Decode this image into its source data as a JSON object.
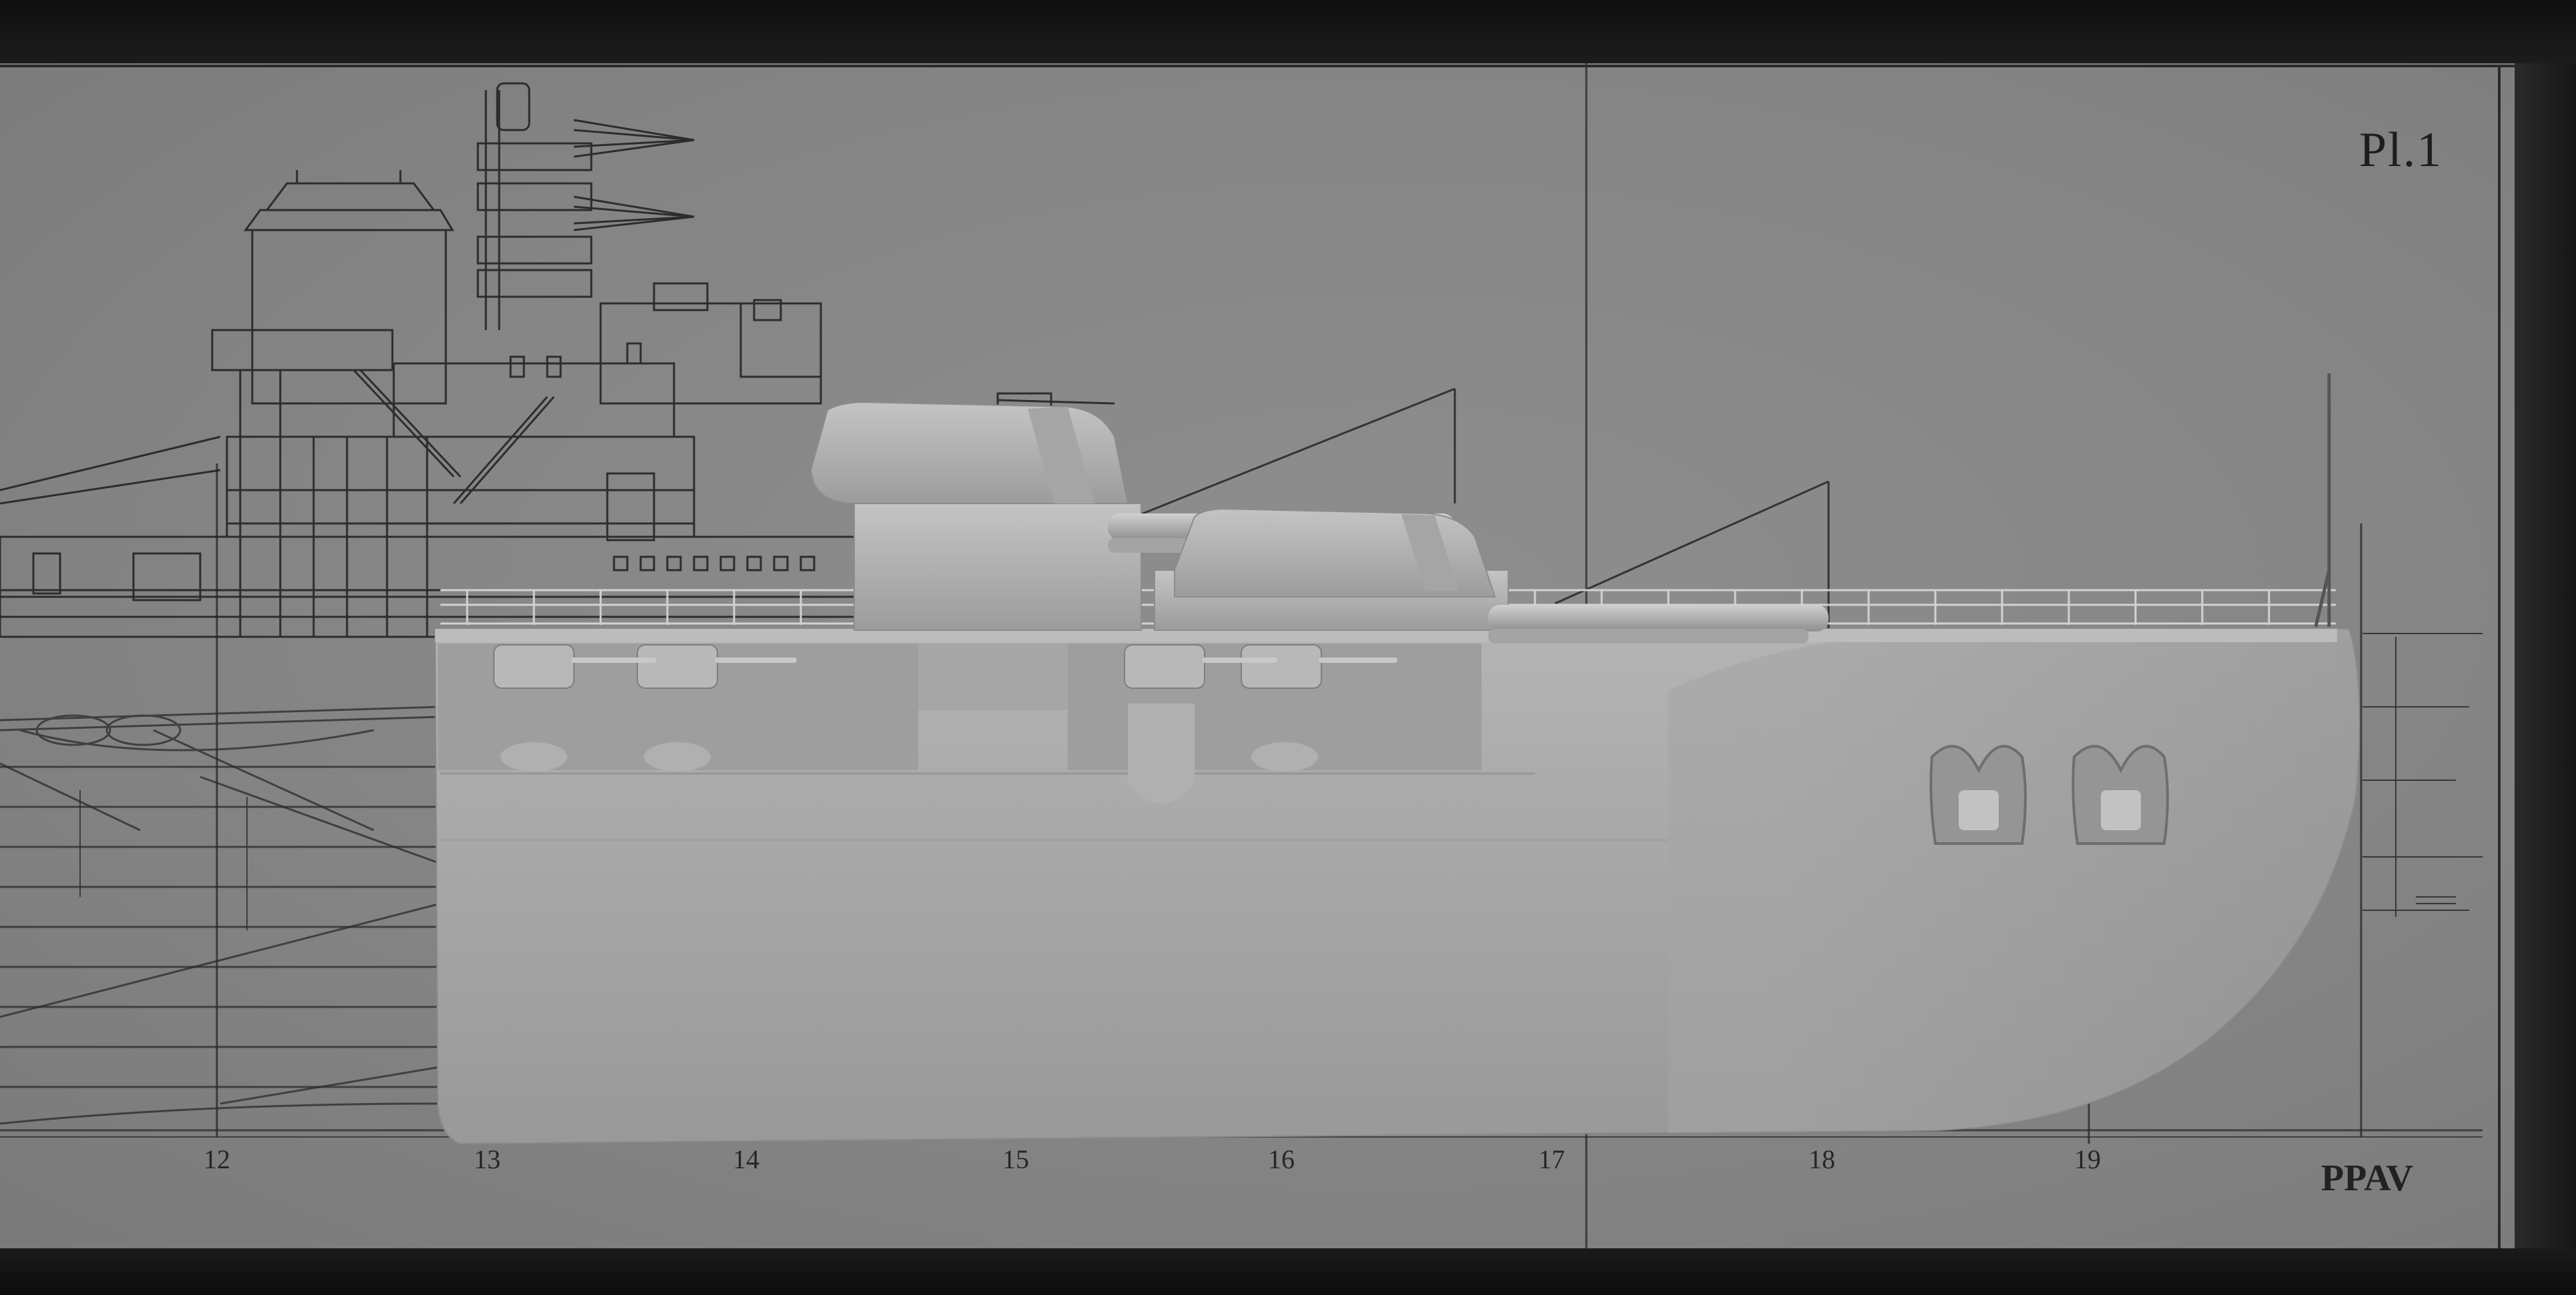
{
  "plate": {
    "label": "Pl.1"
  },
  "perpendicular": {
    "label": "PPAV"
  },
  "stations": [
    "12",
    "13",
    "14",
    "15",
    "16",
    "17",
    "18",
    "19"
  ],
  "colors": {
    "paper": "#858585",
    "ink": "#1e1e1e",
    "hull": "#a9a9a9",
    "frame": "#141414"
  }
}
